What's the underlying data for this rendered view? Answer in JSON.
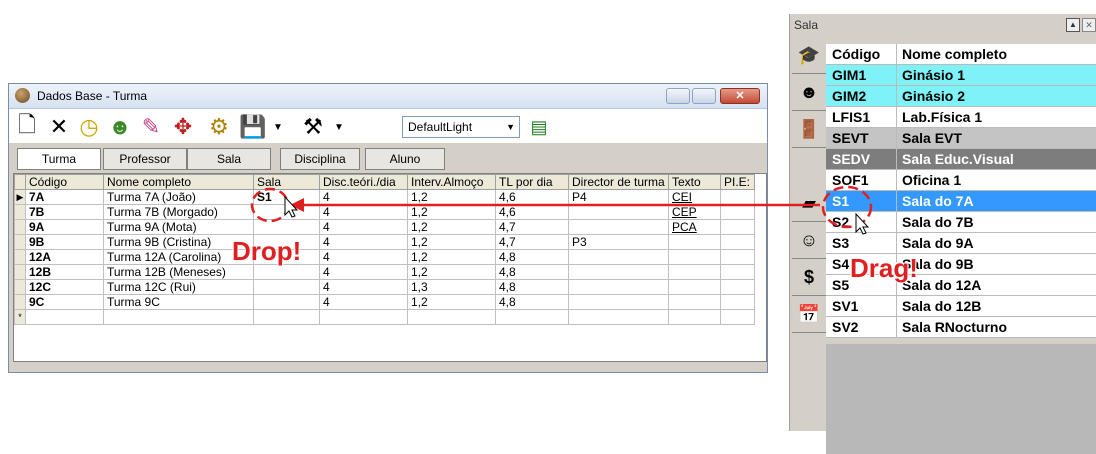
{
  "window": {
    "title": "Dados Base - Turma",
    "style_select": "DefaultLight",
    "tabs": [
      "Turma",
      "Professor",
      "Sala",
      "Disciplina",
      "Aluno"
    ],
    "columns": [
      "Código",
      "Nome completo",
      "Sala",
      "Disc.teóri./dia",
      "Interv.Almoço",
      "TL por dia",
      "Director de turma",
      "Texto",
      "PI.E:"
    ],
    "rows": [
      {
        "code": "7A",
        "name": "Turma 7A (João)",
        "sala": "S1",
        "disc": "4",
        "interv": "1,2",
        "tl": "4,6",
        "dir": "P4",
        "texto": "CEI"
      },
      {
        "code": "7B",
        "name": "Turma 7B (Morgado)",
        "sala": "",
        "disc": "4",
        "interv": "1,2",
        "tl": "4,6",
        "dir": "",
        "texto": "CEP"
      },
      {
        "code": "9A",
        "name": "Turma 9A (Mota)",
        "sala": "",
        "disc": "4",
        "interv": "1,2",
        "tl": "4,7",
        "dir": "",
        "texto": "PCA"
      },
      {
        "code": "9B",
        "name": "Turma 9B (Cristina)",
        "sala": "",
        "disc": "4",
        "interv": "1,2",
        "tl": "4,7",
        "dir": "P3",
        "texto": ""
      },
      {
        "code": "12A",
        "name": "Turma 12A (Carolina)",
        "sala": "",
        "disc": "4",
        "interv": "1,2",
        "tl": "4,8",
        "dir": "",
        "texto": ""
      },
      {
        "code": "12B",
        "name": "Turma 12B (Meneses)",
        "sala": "",
        "disc": "4",
        "interv": "1,2",
        "tl": "4,8",
        "dir": "",
        "texto": ""
      },
      {
        "code": "12C",
        "name": "Turma 12C (Rui)",
        "sala": "",
        "disc": "4",
        "interv": "1,3",
        "tl": "4,8",
        "dir": "",
        "texto": ""
      },
      {
        "code": "9C",
        "name": "Turma 9C",
        "sala": "",
        "disc": "4",
        "interv": "1,2",
        "tl": "4,8",
        "dir": "",
        "texto": ""
      }
    ],
    "new_row_marker": "*",
    "current_row_marker": "▶"
  },
  "sala_panel": {
    "title": "Sala",
    "header_code": "Código",
    "header_name": "Nome completo",
    "rows": [
      {
        "code": "GIM1",
        "name": "Ginásio 1",
        "bg": "#7ef2f6"
      },
      {
        "code": "GIM2",
        "name": "Ginásio 2",
        "bg": "#7ef2f6"
      },
      {
        "code": "LFIS1",
        "name": "Lab.Física 1",
        "bg": "#ffffff"
      },
      {
        "code": "SEVT",
        "name": "Sala EVT",
        "bg": "#c4c4c4"
      },
      {
        "code": "SEDV",
        "name": "Sala Educ.Visual",
        "bg": "#7d7d7d"
      },
      {
        "code": "SOF1",
        "name": "Oficina 1",
        "bg": "#ffffff"
      },
      {
        "code": "S1",
        "name": "Sala do 7A",
        "bg": "#3399ff"
      },
      {
        "code": "S2",
        "name": "Sala do 7B",
        "bg": "#ffffff"
      },
      {
        "code": "S3",
        "name": "Sala do 9A",
        "bg": "#ffffff"
      },
      {
        "code": "S4",
        "name": "Sala do 9B",
        "bg": "#ffffff"
      },
      {
        "code": "S5",
        "name": "Sala do 12A",
        "bg": "#ffffff"
      },
      {
        "code": "SV1",
        "name": "Sala do 12B",
        "bg": "#ffffff"
      },
      {
        "code": "SV2",
        "name": "Sala RNocturno",
        "bg": "#ffffff"
      }
    ]
  },
  "annotations": {
    "drop": "Drop!",
    "drag": "Drag!"
  },
  "colors": {
    "accent_red": "#e02020",
    "selected": "#3399ff",
    "cyan": "#7ef2f6"
  }
}
